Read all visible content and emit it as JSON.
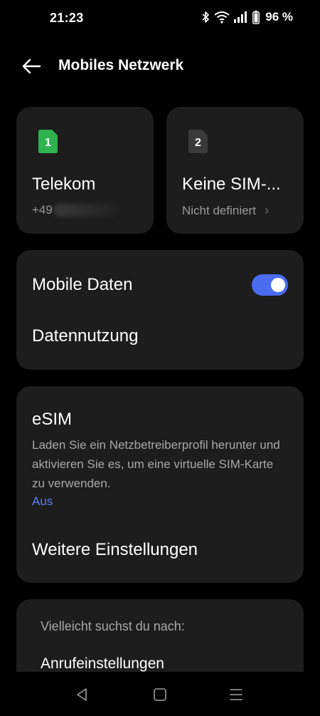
{
  "status_bar": {
    "time": "21:23",
    "battery": "96 %",
    "icons": [
      "bluetooth-icon",
      "wifi-icon",
      "signal-icon",
      "battery-icon"
    ]
  },
  "header": {
    "title": "Mobiles Netzwerk",
    "back_icon": "arrow-left-icon"
  },
  "sim_cards": [
    {
      "slot": "1",
      "name": "Telekom",
      "number": "+49",
      "color": "#2fb24f"
    },
    {
      "slot": "2",
      "name": "Keine SIM-...",
      "status": "Nicht definiert",
      "color": "#3a3a3a"
    }
  ],
  "mobile_data": {
    "label": "Mobile Daten",
    "enabled": true,
    "usage_label": "Datennutzung"
  },
  "esim": {
    "title": "eSIM",
    "description": "Laden Sie ein Netzbetreiberprofil herunter und aktivieren Sie es, um eine virtuelle SIM-Karte zu verwenden.",
    "status": "Aus",
    "more_settings": "Weitere Einstellungen"
  },
  "suggestions": {
    "heading": "Vielleicht suchst du nach:",
    "items": [
      "Anrufeinstellungen"
    ]
  },
  "nav_bar": {
    "icons": [
      "back-triangle-icon",
      "home-square-icon",
      "menu-lines-icon"
    ]
  },
  "colors": {
    "background": "#000000",
    "card": "#1d1d1d",
    "accent": "#4a6cf0",
    "link": "#5b7dff"
  }
}
